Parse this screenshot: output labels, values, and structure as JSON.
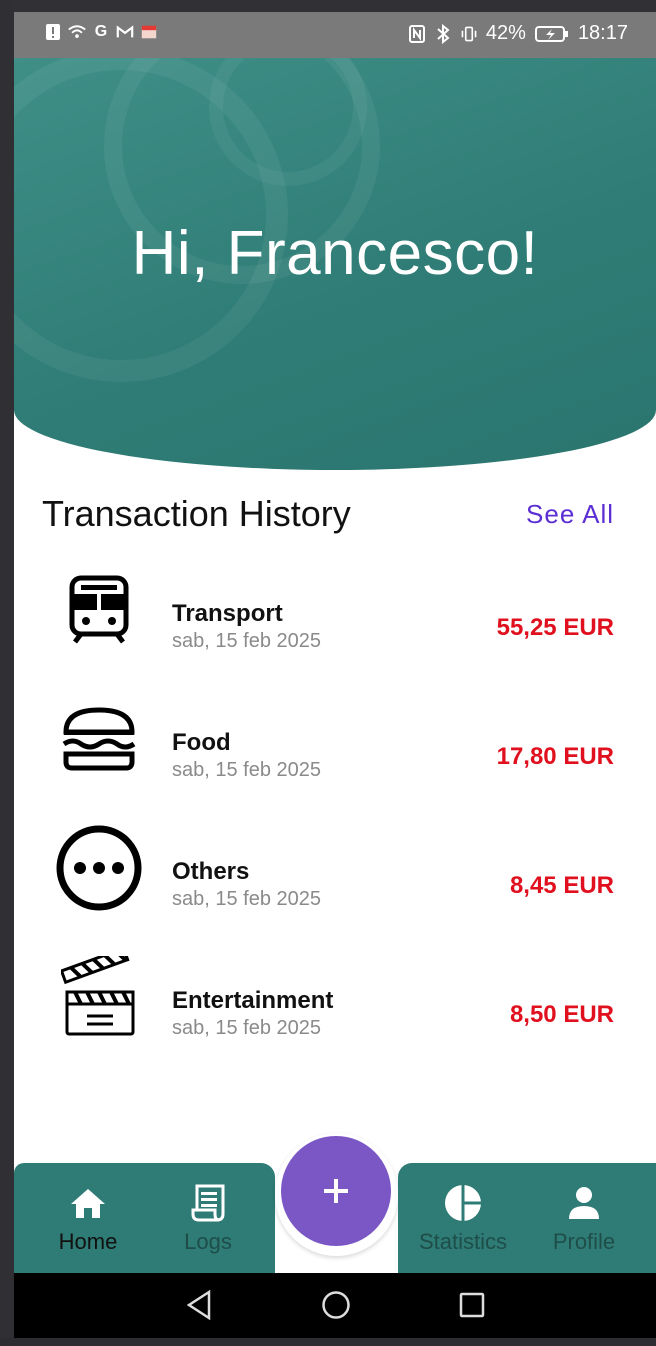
{
  "status_bar": {
    "battery": "42%",
    "time": "18:17",
    "left_icons": [
      "alert-icon",
      "wifi-icon",
      "google-icon",
      "gmail-icon",
      "box-icon"
    ],
    "right_icons": [
      "nfc-icon",
      "bluetooth-icon",
      "vibrate-icon",
      "battery-icon"
    ]
  },
  "header": {
    "greeting": "Hi, Francesco!",
    "color": "#2f7d76"
  },
  "transactions_section": {
    "title": "Transaction History",
    "see_all": "See All",
    "see_all_color": "#5b2fd3"
  },
  "transactions": [
    {
      "category": "Transport",
      "date": "sab, 15 feb 2025",
      "amount": "55,25 EUR",
      "icon": "train-icon"
    },
    {
      "category": "Food",
      "date": "sab, 15 feb 2025",
      "amount": "17,80 EUR",
      "icon": "burger-icon"
    },
    {
      "category": "Others",
      "date": "sab, 15 feb 2025",
      "amount": "8,45 EUR",
      "icon": "more-icon"
    },
    {
      "category": "Entertainment",
      "date": "sab, 15 feb 2025",
      "amount": "8,50 EUR",
      "icon": "clapperboard-icon"
    }
  ],
  "amount_color": "#e0101e",
  "bottom_nav": {
    "items": [
      {
        "label": "Home",
        "icon": "home-icon",
        "active": true
      },
      {
        "label": "Logs",
        "icon": "receipt-icon",
        "active": false
      },
      {
        "label": "Statistics",
        "icon": "pie-chart-icon",
        "active": false
      },
      {
        "label": "Profile",
        "icon": "person-icon",
        "active": false
      }
    ],
    "fab_icon": "plus-icon",
    "fab_color": "#7b57c6"
  },
  "system_nav": [
    "back-icon",
    "home-circle-icon",
    "recents-icon"
  ]
}
